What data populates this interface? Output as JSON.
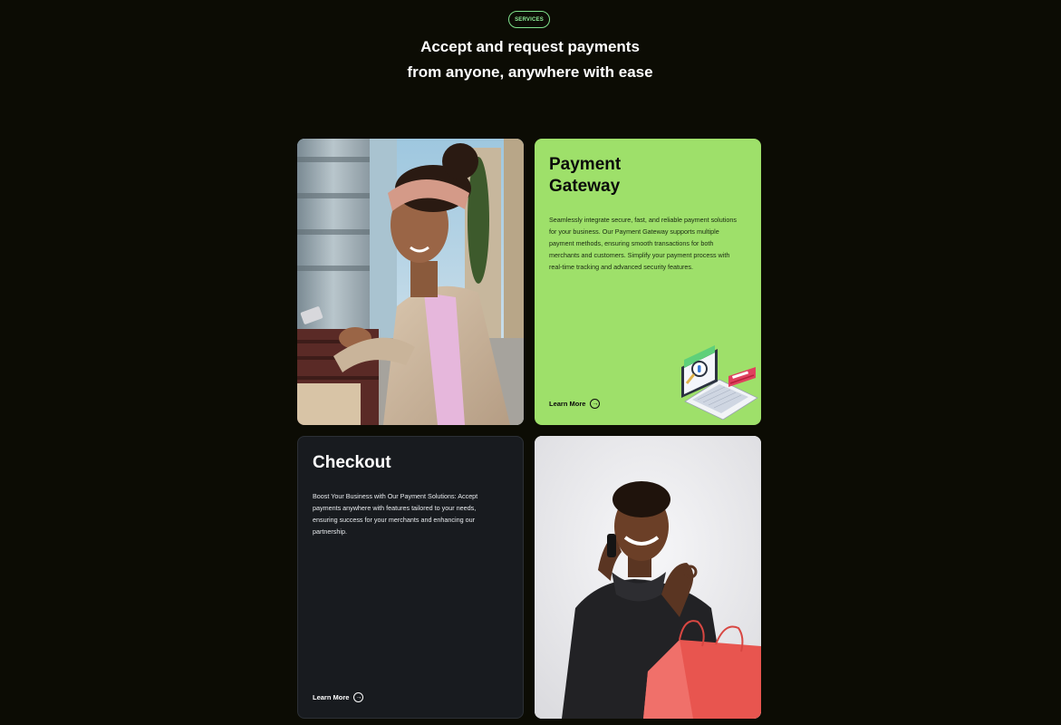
{
  "badge": "SERVICES",
  "headline": {
    "line1": "Accept and request payments",
    "line2": "from anyone, anywhere with ease"
  },
  "cards": {
    "payment_gateway": {
      "title": "Payment Gateway",
      "description": "Seamlessly integrate secure, fast, and reliable payment solutions for your business. Our Payment Gateway supports multiple payment methods, ensuring smooth transactions for both merchants and customers. Simplify your payment process with real-time tracking and advanced security features.",
      "cta": "Learn More"
    },
    "checkout": {
      "title": "Checkout",
      "description": "Boost Your Business with Our Payment Solutions: Accept payments anywhere with features tailored to your needs, ensuring success for your merchants and enhancing our partnership.",
      "cta": "Learn More"
    }
  },
  "icons": {
    "cta_icon": "arrow-right-circle-icon",
    "illustration": "laptop-payment-illustration"
  },
  "colors": {
    "background": "#0c0c04",
    "accent_green": "#9ee06a",
    "badge_green": "#7fe08a",
    "dark_card": "#181b1f"
  }
}
